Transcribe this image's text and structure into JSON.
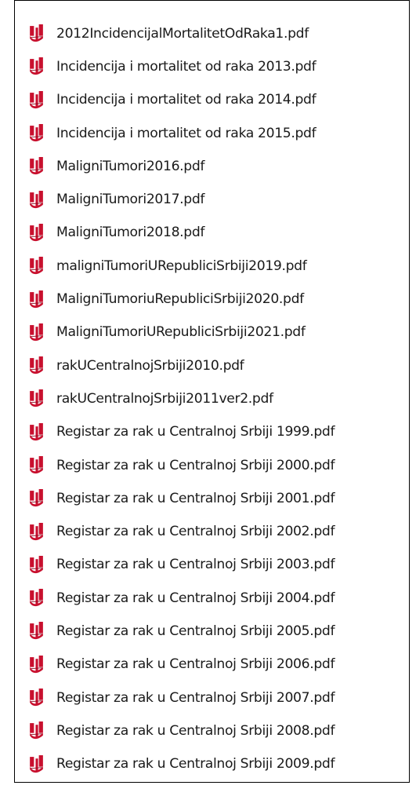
{
  "window": {
    "title": ""
  },
  "file_icon": {
    "name": "pdf-file-icon",
    "color": "#C8102E"
  },
  "files": [
    {
      "name": "2012IncidencijalMortalitetOdRaka1.pdf"
    },
    {
      "name": "Incidencija i mortalitet od raka 2013.pdf"
    },
    {
      "name": "Incidencija i mortalitet od raka 2014.pdf"
    },
    {
      "name": "Incidencija i mortalitet od raka 2015.pdf"
    },
    {
      "name": "MaligniTumori2016.pdf"
    },
    {
      "name": "MaligniTumori2017.pdf"
    },
    {
      "name": "MaligniTumori2018.pdf"
    },
    {
      "name": "maligniTumoriURepubliciSrbiji2019.pdf"
    },
    {
      "name": "MaligniTumoriuRepubliciSrbiji2020.pdf"
    },
    {
      "name": "MaligniTumoriURepubliciSrbiji2021.pdf"
    },
    {
      "name": "rakUCentralnojSrbiji2010.pdf"
    },
    {
      "name": "rakUCentralnojSrbiji2011ver2.pdf"
    },
    {
      "name": "Registar za rak u Centralnoj Srbiji 1999.pdf"
    },
    {
      "name": "Registar za rak u Centralnoj Srbiji 2000.pdf"
    },
    {
      "name": "Registar za rak u Centralnoj Srbiji 2001.pdf"
    },
    {
      "name": "Registar za rak u Centralnoj Srbiji 2002.pdf"
    },
    {
      "name": "Registar za rak u Centralnoj Srbiji 2003.pdf"
    },
    {
      "name": "Registar za rak u Centralnoj Srbiji 2004.pdf"
    },
    {
      "name": "Registar za rak u Centralnoj Srbiji 2005.pdf"
    },
    {
      "name": "Registar za rak u Centralnoj Srbiji 2006.pdf"
    },
    {
      "name": "Registar za rak u Centralnoj Srbiji 2007.pdf"
    },
    {
      "name": "Registar za rak u Centralnoj Srbiji 2008.pdf"
    },
    {
      "name": "Registar za rak u Centralnoj Srbiji 2009.pdf"
    }
  ]
}
